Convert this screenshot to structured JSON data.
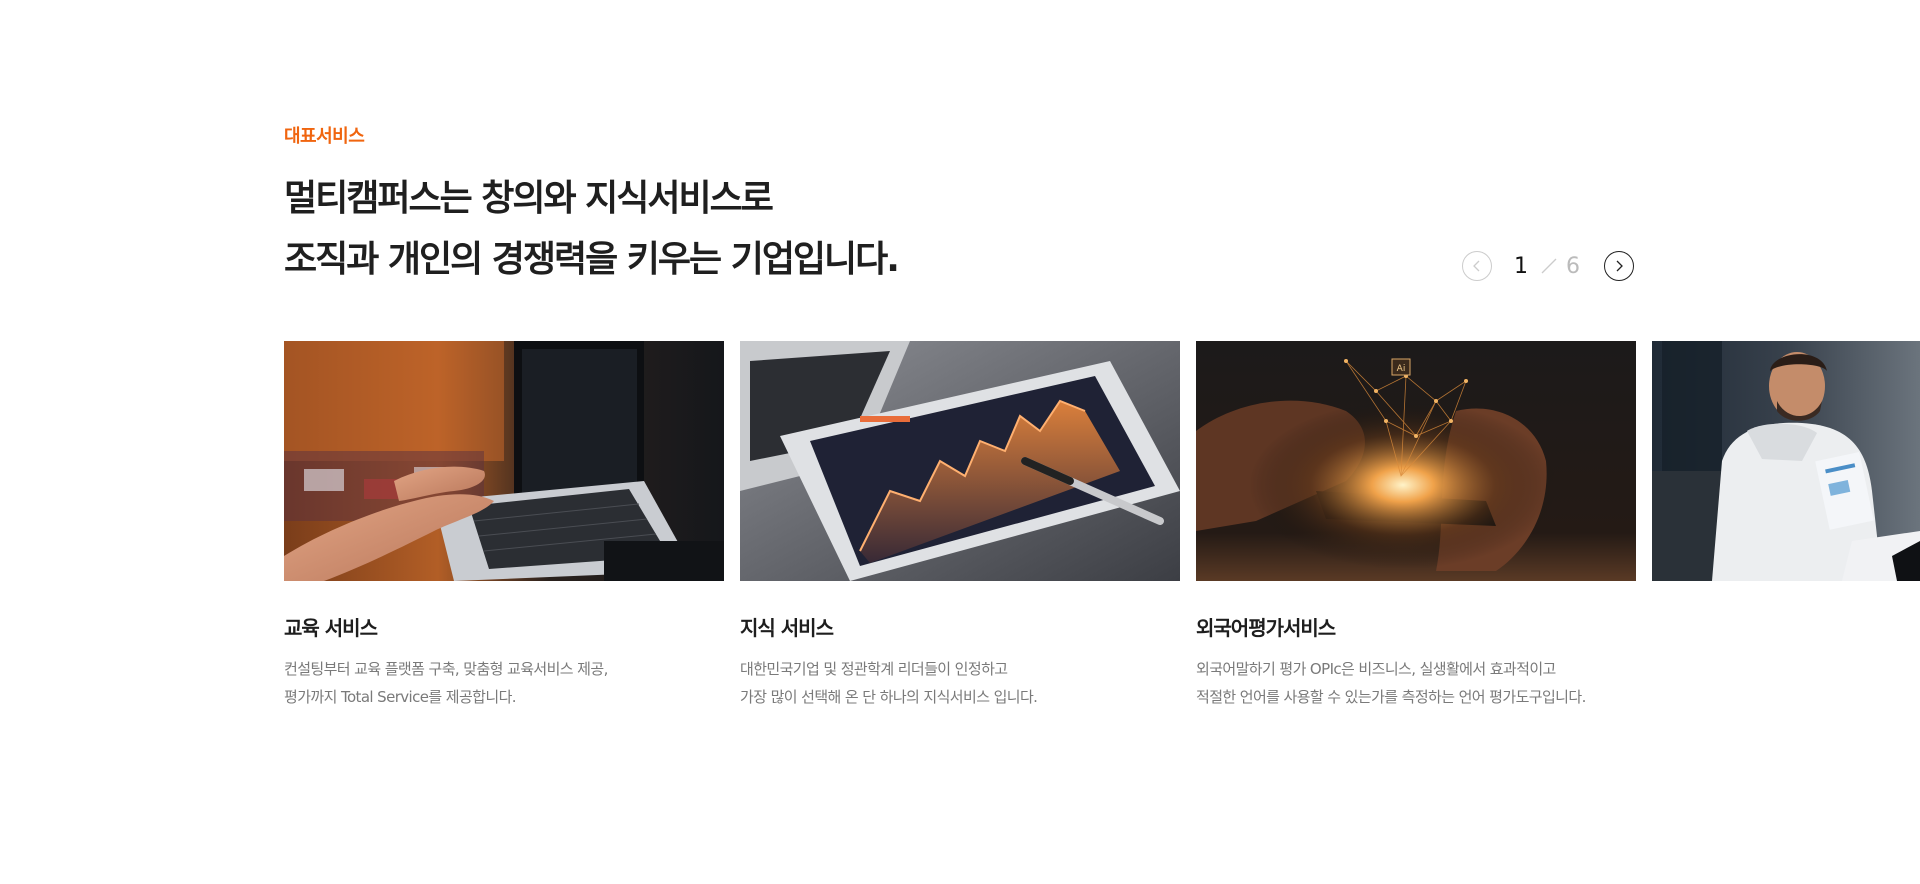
{
  "section": {
    "eyebrow": "대표서비스",
    "headline": {
      "line1": "멀티캠퍼스는 창의와 지식서비스로",
      "line2": "조직과 개인의 경쟁력을 키우는 기업입니다."
    }
  },
  "pager": {
    "current": "1",
    "total": "6",
    "prev_icon": "chevron-left-icon",
    "next_icon": "chevron-right-icon"
  },
  "cards": [
    {
      "title": "교육 서비스",
      "desc_line1": "컨설팅부터 교육 플랫폼 구축, 맞춤형 교육서비스 제공,",
      "desc_line2": "평가까지 Total Service를 제공합니다.",
      "image": "laptop-typing-photo"
    },
    {
      "title": "지식 서비스",
      "desc_line1": "대한민국기업 및 정관학계 리더들이 인정하고",
      "desc_line2": "가장 많이 선택해 온 단 하나의 지식서비스 입니다.",
      "image": "tablet-chart-photo"
    },
    {
      "title": "외국어평가서비스",
      "desc_line1": "외국어말하기 평가 OPIc은 비즈니스, 실생활에서 효과적이고",
      "desc_line2": "적절한 언어를 사용할 수 있는가를 측정하는 언어 평가도구입니다.",
      "image": "smartphone-ai-photo",
      "image_text": "Ai"
    },
    {
      "title": "",
      "desc_line1": "",
      "desc_line2": "",
      "image": "businessman-presentation-photo"
    }
  ],
  "colors": {
    "accent": "#f0650f",
    "title": "#1f1f1f",
    "body": "#7a7a7a",
    "pager_inactive": "#bbbbbb"
  }
}
